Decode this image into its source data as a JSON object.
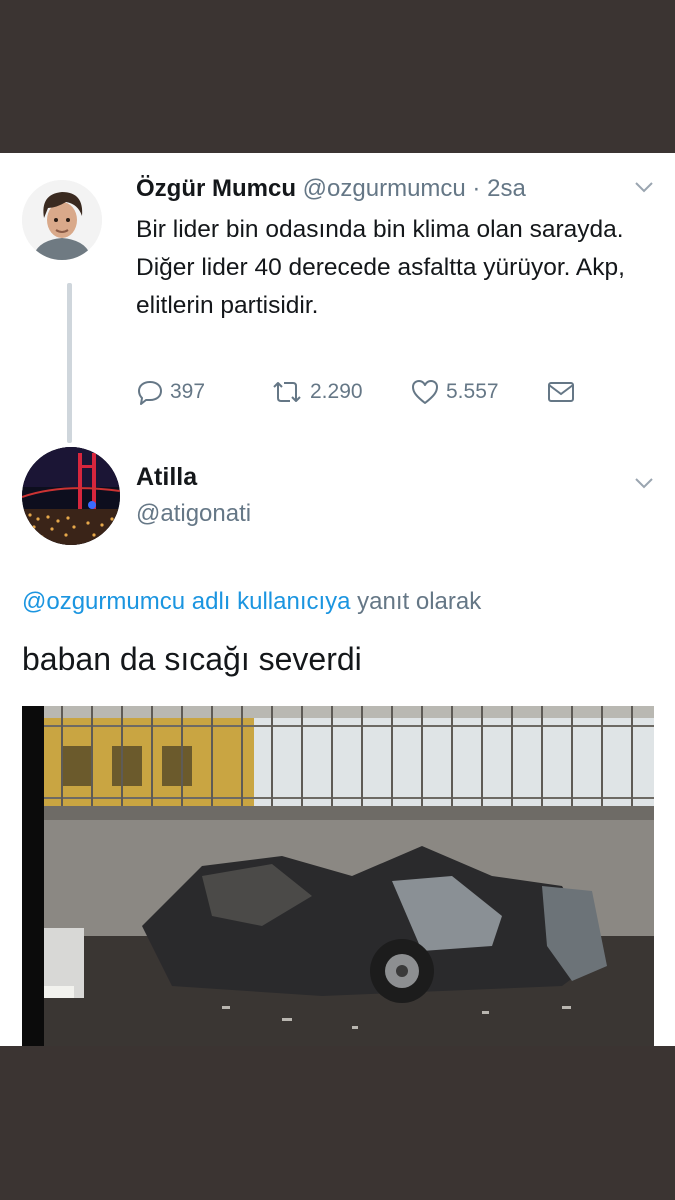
{
  "tweet": {
    "author_name": "Özgür Mumcu",
    "author_handle": "@ozgurmumcu",
    "separator": "·",
    "time": "2sa",
    "text": "Bir lider bin odasında bin klima olan sarayda. Diğer lider 40 derecede asfaltta yürüyor. Akp, elitlerin partisidir.",
    "replies": "397",
    "retweets": "2.290",
    "likes": "5.557"
  },
  "reply": {
    "author_name": "Atilla",
    "author_handle": "@atigonati",
    "reply_mention": "@ozgurmumcu adlı kullanıcıya",
    "reply_suffix": "yanıt olarak",
    "text": "baban da sıcağı severdi"
  },
  "colors": {
    "background": "#3b3432",
    "card": "#ffffff",
    "text": "#14171a",
    "secondary": "#657786",
    "link": "#1b95e0"
  },
  "icons": [
    "reply-icon",
    "retweet-icon",
    "like-icon",
    "dm-icon",
    "chevron-down-icon"
  ]
}
